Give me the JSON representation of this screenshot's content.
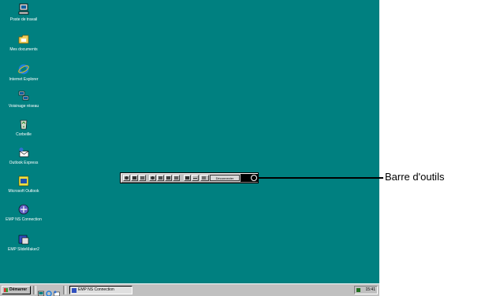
{
  "desktop": {
    "background": "#008080",
    "icons": [
      {
        "label": "Poste de travail",
        "icon": "my-computer-icon"
      },
      {
        "label": "Mes documents",
        "icon": "folder-icon"
      },
      {
        "label": "Internet Explorer",
        "icon": "internet-explorer-icon"
      },
      {
        "label": "Voisinage réseau",
        "icon": "network-icon"
      },
      {
        "label": "Corbeille",
        "icon": "recycle-bin-icon"
      },
      {
        "label": "Outlook Express",
        "icon": "outlook-express-icon"
      },
      {
        "label": "Microsoft Outlook",
        "icon": "outlook-icon"
      },
      {
        "label": "EMP NS Connection",
        "icon": "emp-ns-icon"
      },
      {
        "label": "EMP SlideMaker2",
        "icon": "slidemaker-icon"
      }
    ]
  },
  "toolbar": {
    "disconnect_label": "Déconnecter"
  },
  "callout": {
    "label": "Barre d'outils"
  },
  "taskbar": {
    "start_label": "Démarrer",
    "task_label": "EMP NS Connection",
    "clock": "15:41"
  }
}
